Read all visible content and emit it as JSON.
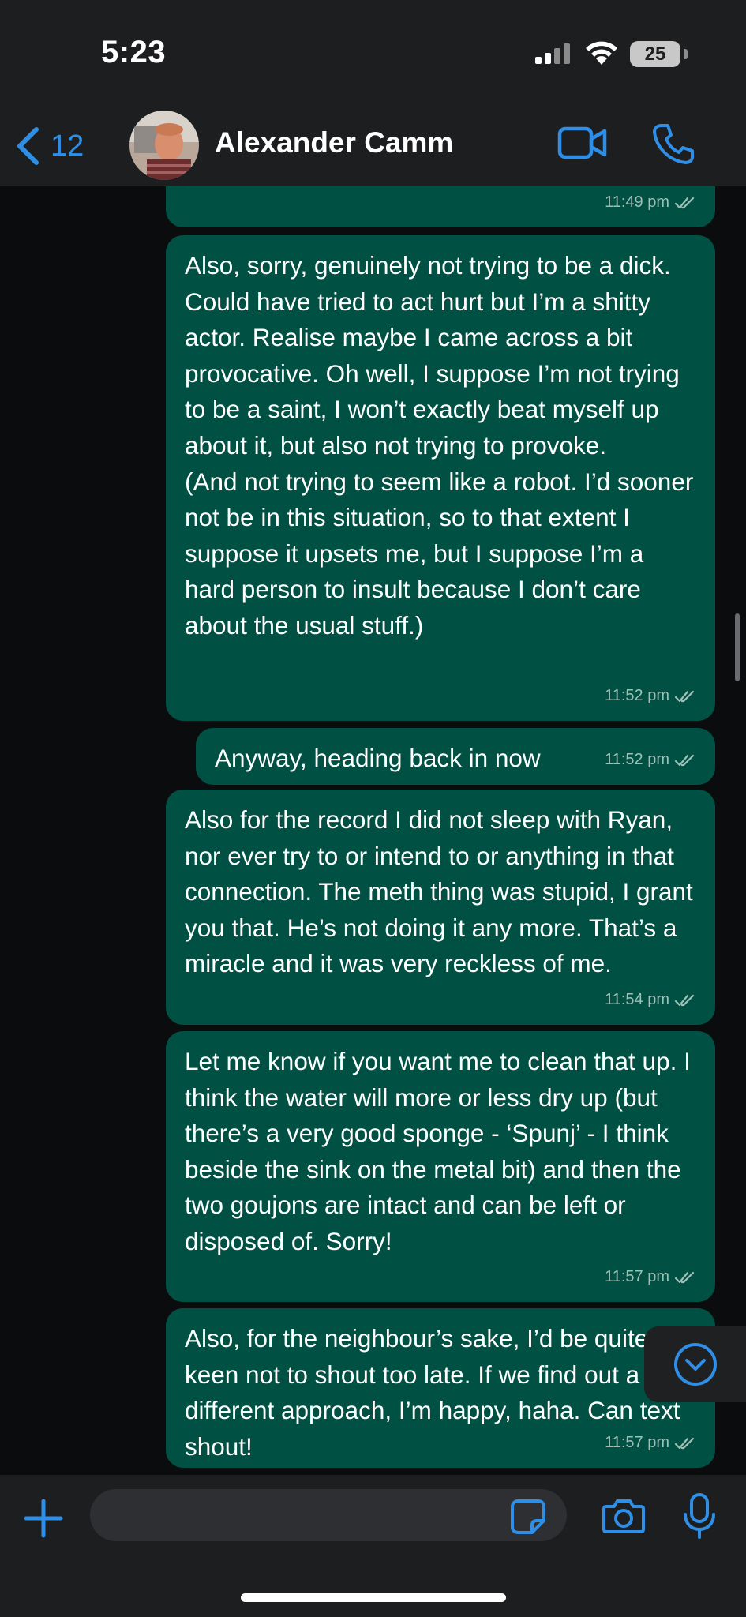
{
  "status_bar": {
    "time": "5:23",
    "battery": "25"
  },
  "header": {
    "back_count": "12",
    "contact_name": "Alexander Camm"
  },
  "messages": [
    {
      "text": "",
      "time": "11:49 pm"
    },
    {
      "text": "Also, sorry, genuinely not trying to be a dick. Could have tried to act hurt but I’m a shitty actor. Realise maybe I came across a bit provocative. Oh well, I suppose I’m not trying to be a saint, I won’t exactly beat myself up about it, but also not trying to provoke.\n(And not trying to seem like a robot. I’d sooner not be in this situation, so to that extent I suppose it upsets me, but I suppose I’m a hard person to insult because I don’t care about the usual stuff.)",
      "time": "11:52 pm"
    },
    {
      "text": "Anyway, heading back in now",
      "time": "11:52 pm"
    },
    {
      "text": "Also for the record I did not sleep with Ryan, nor ever try to or intend to or anything in that connection. The meth thing was stupid, I grant you that. He’s not doing it any more. That’s a miracle and it was very reckless of me.",
      "time": "11:54 pm"
    },
    {
      "text": "Let me know if you want me to clean that up. I think the water will more or less dry up (but there’s a very good sponge - ‘Spunj’ - I think beside the sink on the metal bit) and then the two goujons are intact and can be left or disposed of. Sorry!",
      "time": "11:57 pm"
    },
    {
      "text": "Also, for the neighbour’s sake, I’d be quite keen not to shout too late. If we find out a different approach, I’m happy, haha. Can text shout!",
      "time": "11:57 pm"
    }
  ],
  "composer": {
    "placeholder": ""
  },
  "colors": {
    "outgoing_bubble": "#005143",
    "accent": "#2f8fe6",
    "background": "#0b0c0d",
    "bar": "#1d1e20"
  }
}
